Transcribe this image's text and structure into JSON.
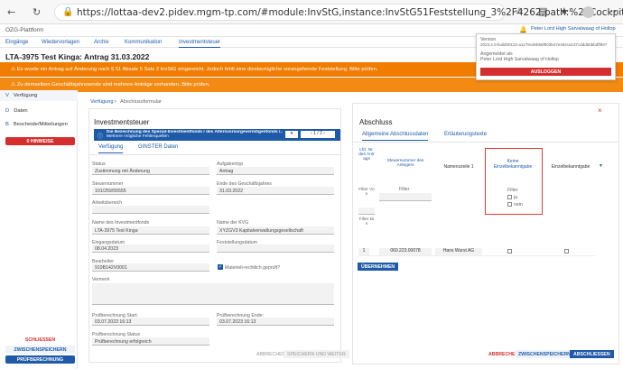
{
  "browser": {
    "url": "https://lottaa-dev2.pidev.mgm-tp.com/#module:InvStG,instance:InvStG51Feststellung_3%2F4262,path:%2FCockpit%..."
  },
  "app": {
    "name": "OZG-Plattform",
    "menu": [
      "Eingänge",
      "Wiedervorlagen",
      "Archiv",
      "Kommunikation",
      "Investmentsteuer"
    ],
    "page_title": "LTA-3975 Test Kinga: Antrag 31.03.2022",
    "user_link": "Peter Lord High Sarvalwaag of Hollop"
  },
  "banners": [
    "Es wurde ein Antrag auf Änderung nach § 51 Absatz 5 Satz 2 InvStG eingereicht. Jedoch fehlt eine diesbezügliche vorangehende Feststellung. Bitte prüfen.",
    "Zu demselben Geschäftsjahresende sind mehrere Anträge vorhanden. Bitte prüfen."
  ],
  "user_menu": {
    "version_label": "Version",
    "version": "2023.2.0-build00122-a1179cdeb55f903b47e492ca137cddd50bbdff697",
    "logged_in_label": "Angemeldet als",
    "user": "Peter Lord High Sarvalwaag of Hollop",
    "logout": "AUSLOGGEN"
  },
  "sidebar": {
    "items": [
      {
        "letter": "V",
        "label": "Verfügung"
      },
      {
        "letter": "D",
        "label": "Daten"
      },
      {
        "letter": "B",
        "label": "Bescheide/Mitteilungen"
      }
    ],
    "hint_button": "0 HINWEISE",
    "close": "SCHLIESSEN",
    "save": "ZWISCHENSPEICHERN",
    "check": "PRÜFBERECHNUNG"
  },
  "breadcrumb": {
    "first": "Verfügung",
    "sep": ">",
    "second": "Abschlussformular"
  },
  "left_panel": {
    "heading": "Investmentsteuer",
    "info": "Die Bezeichnung des Spezial-Investmentfonds / des Altersvorsorgevermögenfonds /...",
    "info_sub": "Mehrere mögliche Fehlerquellen",
    "pager": "1 / 2",
    "tabs": [
      "Verfügung",
      "GINSTER Daten"
    ],
    "fields": {
      "status_label": "Status",
      "status_value": "Zustimmung mit Änderung",
      "auftragstyp_label": "Aufgabentyp",
      "auftragstyp_value": "Antrag",
      "steuernummer_label": "Steuernummer",
      "steuernummer_value": "101/259/55555",
      "ende_label": "Ende des Geschäftsjahres",
      "ende_value": "31.03.2022",
      "arbeitsbereich_label": "Arbeitsbereich",
      "fonds_label": "Name des Investmentfonds",
      "fonds_value": "LTA-3975 Test Kinga",
      "kvg_label": "Name der KVG",
      "kvg_value": "XYZGV3 Kapitalverwaltungsgesellschaft",
      "eingang_label": "Eingangsdatum",
      "eingang_value": "08.04.2023",
      "feststellung_label": "Feststellungsdatum",
      "bearbeiter_label": "Bearbeiter",
      "bearbeiter_value": "919B142V0001",
      "checkbox_label": "Materiell-rechtlich geprüft?",
      "vermerk_label": "Vermerk",
      "pb_start_label": "Prüfberechnung Start:",
      "pb_start_value": "03.07.2023 16:13",
      "pb_ende_label": "Prüfberechnung Ende:",
      "pb_ende_value": "03.07.2023 16:13",
      "pb_status_label": "Prüfberechnung Status",
      "pb_status_value": "Prüfberechnung erfolgreich"
    },
    "footer": [
      "ABBRECHEN",
      "SPEICHERN UND WEITER"
    ]
  },
  "right_panel": {
    "heading": "Abschluss",
    "close": "×",
    "tabs": [
      "Allgemeine Abschlussdaten",
      "Erläuterungstexte"
    ],
    "columns": [
      "Lfd. Nr. des Antrags",
      "Steuernummer des Anlegers",
      "Namenszeile 1",
      "Keine Einzelbekanntgabe",
      "Einzelbekanntgabe"
    ],
    "filter_label": "Filter",
    "filter_von": "Filter Von",
    "filter_bis": "Filter Bis",
    "ja": "ja",
    "nein": "nein",
    "row": {
      "nr": "1",
      "steuernummer": "060.223.00078",
      "name": "Hans Wurst AG"
    },
    "apply": "ÜBERNEHMEN",
    "footer": [
      "ABBRECHEN",
      "ZWISCHENSPEICHERN",
      "ABSCHLIESSEN"
    ]
  },
  "colors": {
    "brand": "#1e5aa8",
    "warning": "#f07c00",
    "danger": "#d32f2f",
    "highlight": "#e53935"
  }
}
